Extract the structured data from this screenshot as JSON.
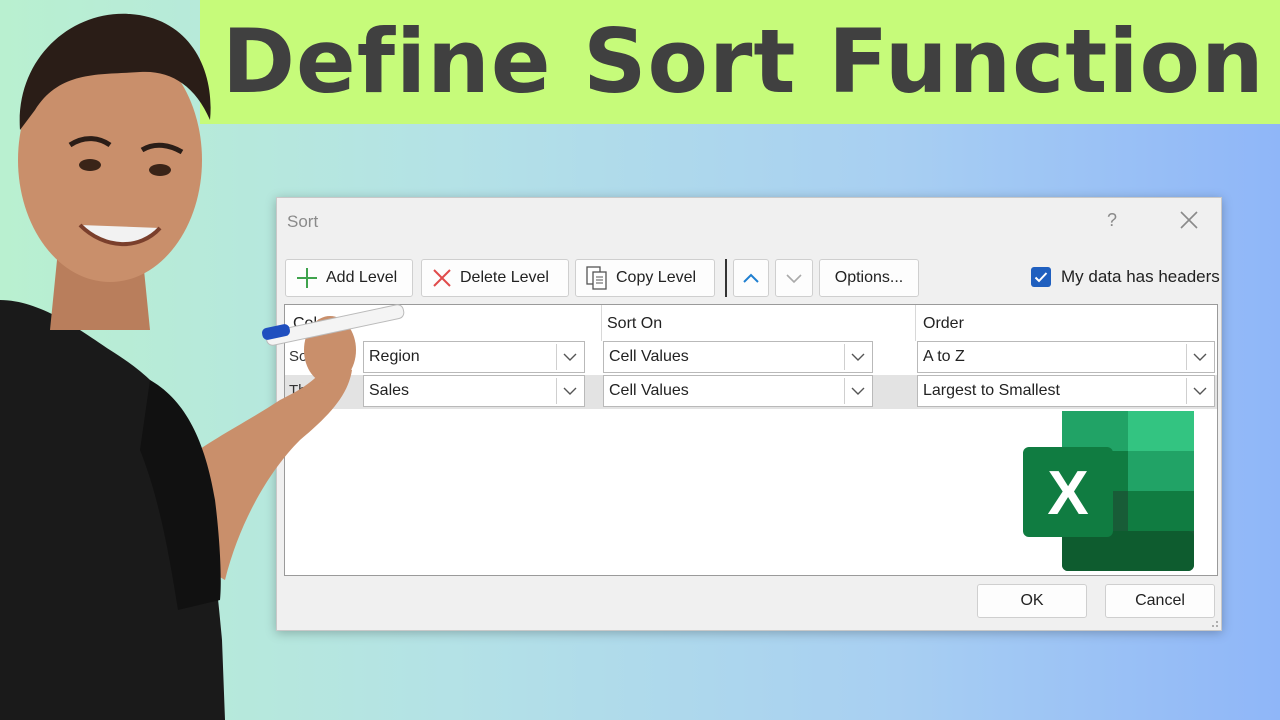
{
  "headline": "Define Sort Function",
  "dialog": {
    "title": "Sort",
    "help": "?",
    "toolbar": {
      "add_level": "Add Level",
      "delete_level": "Delete Level",
      "copy_level": "Copy Level",
      "options": "Options...",
      "headers_label": "My data has headers",
      "headers_checked": true
    },
    "columns": {
      "column": "Column",
      "sort_on": "Sort On",
      "order": "Order"
    },
    "rows": [
      {
        "label": "Sort by",
        "column": "Region",
        "sort_on": "Cell Values",
        "order": "A to Z"
      },
      {
        "label": "Then by",
        "column": "Sales",
        "sort_on": "Cell Values",
        "order": "Largest to Smallest"
      }
    ],
    "ok": "OK",
    "cancel": "Cancel"
  },
  "logo": {
    "letter": "X"
  },
  "colors": {
    "banner": "#c6fb7a",
    "headline_text": "#404040",
    "checkbox": "#1f5fbf",
    "excel_dark": "#107c41",
    "excel_light": "#33c481"
  }
}
